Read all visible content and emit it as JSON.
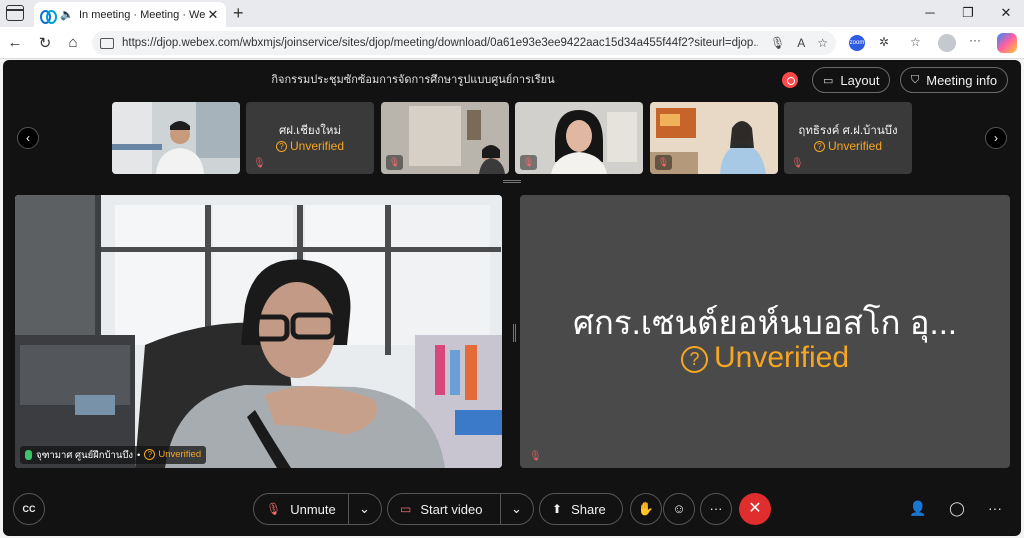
{
  "browser": {
    "tab_title": "In meeting · Meeting · Webe",
    "tab_close": "✕",
    "url": "https://djop.webex.com/wbxmjs/joinservice/sites/djop/meeting/download/0a61e93e3ee9422aac15d34a455f44f2?siteurl=djop...",
    "zoom_ext": "zoom"
  },
  "meeting": {
    "title": "กิจกรรมประชุมซักซ้อมการจัดการศึกษารูปแบบศูนย์การเรียน",
    "layout_label": "Layout",
    "meeting_info_label": "Meeting info",
    "thumbnails": [
      {
        "name": "",
        "status": ""
      },
      {
        "name": "ศฝ.เชียงใหม่",
        "status": "Unverified"
      },
      {
        "name": "",
        "status": ""
      },
      {
        "name": "",
        "status": ""
      },
      {
        "name": "",
        "status": ""
      },
      {
        "name": "ฤทธิรงค์ ศ.ฝ.บ้านบึง",
        "status": "Unverified"
      }
    ],
    "main_video": {
      "name": "จุฑามาศ ศูนย์ฝึกบ้านบึง",
      "separator": "•",
      "status": "Unverified"
    },
    "big_tile": {
      "name": "ศกร.เซนต์ยอห์นบอสโก อุ...",
      "status": "Unverified"
    },
    "controls": {
      "unmute": "Unmute",
      "start_video": "Start video",
      "share": "Share"
    }
  },
  "colors": {
    "accent_unverified": "#f5a623",
    "end_call": "#e02d2d",
    "record": "#fc4a4a"
  }
}
